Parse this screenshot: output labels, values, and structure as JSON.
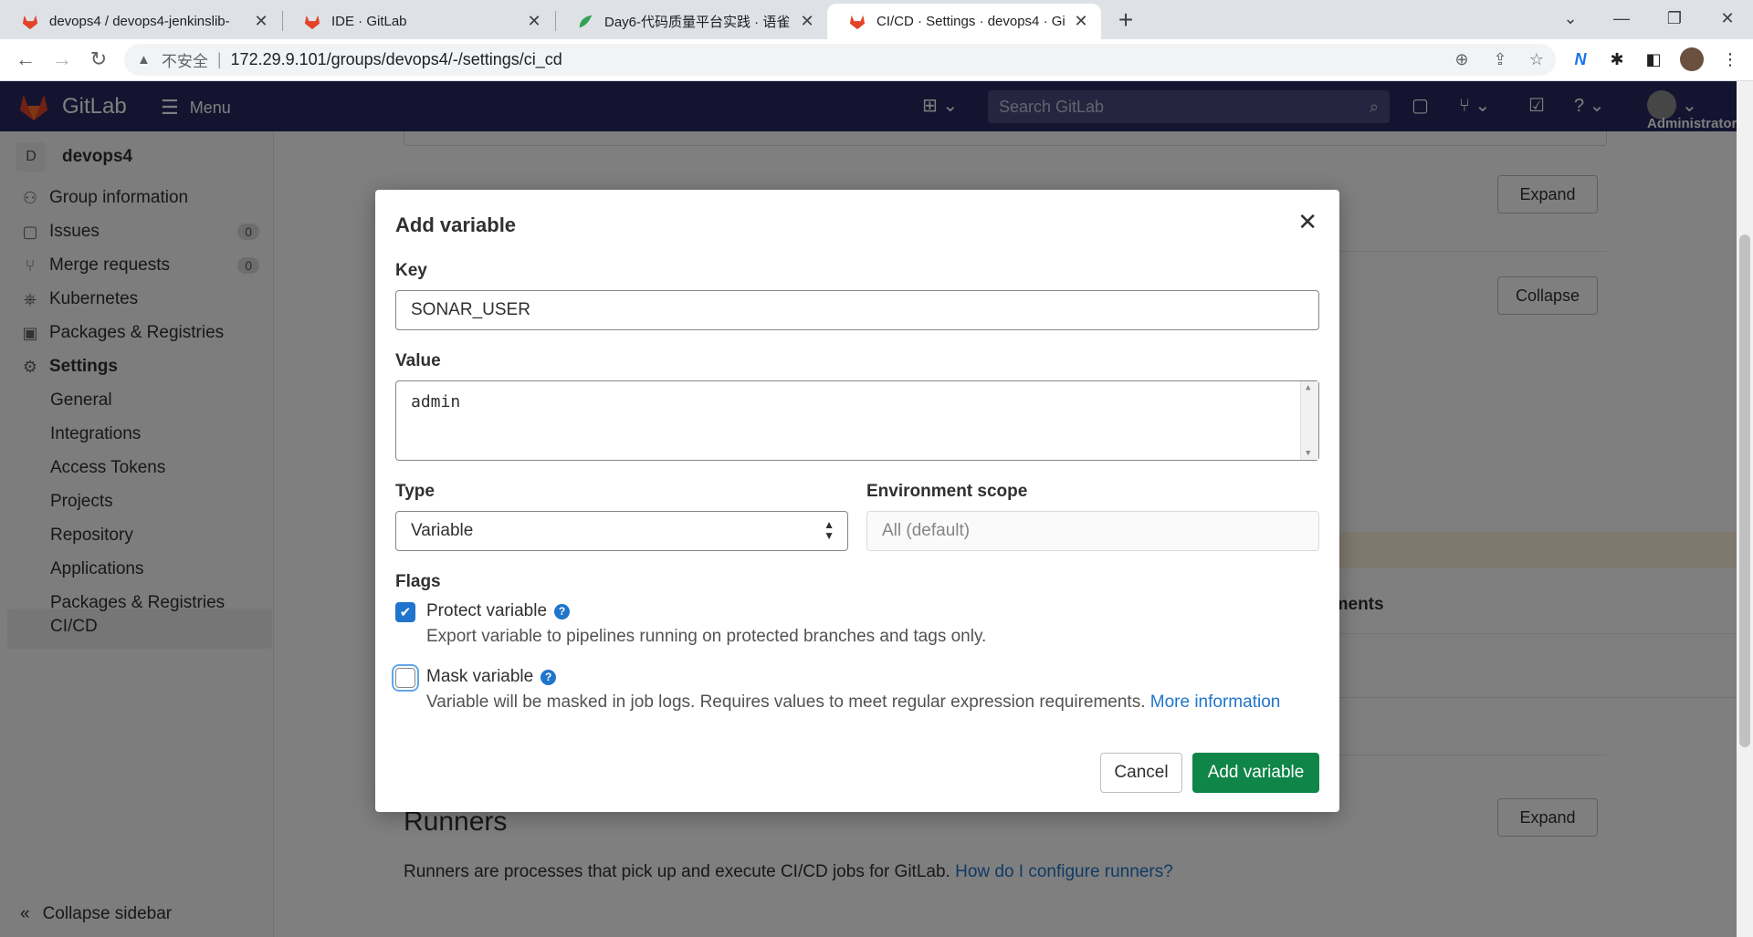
{
  "browser": {
    "tabs": [
      {
        "title": "devops4 / devops4-jenkinslib-",
        "active": false
      },
      {
        "title": "IDE · GitLab",
        "active": false
      },
      {
        "title": "Day6-代码质量平台实践 · 语雀",
        "active": false
      },
      {
        "title": "CI/CD · Settings · devops4 · Gi",
        "active": true
      }
    ],
    "address": {
      "security_label": "不安全",
      "url": "172.29.9.101/groups/devops4/-/settings/ci_cd"
    }
  },
  "gitlab": {
    "brand": "GitLab",
    "menu_label": "Menu",
    "search_placeholder": "Search GitLab",
    "user_label": "Administrator"
  },
  "sidebar": {
    "group_initial": "D",
    "group_name": "devops4",
    "items": [
      {
        "label": "Group information",
        "icon": "group-icon"
      },
      {
        "label": "Issues",
        "icon": "issues-icon",
        "count": "0"
      },
      {
        "label": "Merge requests",
        "icon": "merge-request-icon",
        "count": "0"
      },
      {
        "label": "Kubernetes",
        "icon": "kubernetes-icon"
      },
      {
        "label": "Packages & Registries",
        "icon": "package-icon"
      },
      {
        "label": "Settings",
        "icon": "settings-icon"
      }
    ],
    "sub_items": [
      "General",
      "Integrations",
      "Access Tokens",
      "Projects",
      "Repository",
      "CI/CD",
      "Applications",
      "Packages & Registries"
    ],
    "collapse_label": "Collapse sidebar"
  },
  "content": {
    "expand_label": "Expand",
    "collapse_label": "Collapse",
    "env_text_fragment": "nments",
    "runners_title": "Runners",
    "runners_text": "Runners are processes that pick up and execute CI/CD jobs for GitLab. ",
    "runners_link": "How do I configure runners?"
  },
  "modal": {
    "title": "Add variable",
    "key_label": "Key",
    "key_value": "SONAR_USER",
    "value_label": "Value",
    "value_value": "admin",
    "type_label": "Type",
    "type_value": "Variable",
    "env_label": "Environment scope",
    "env_value": "All (default)",
    "flags_label": "Flags",
    "protect": {
      "label": "Protect variable",
      "checked": true,
      "help": "Export variable to pipelines running on protected branches and tags only."
    },
    "mask": {
      "label": "Mask variable",
      "checked": false,
      "help": "Variable will be masked in job logs. Requires values to meet regular expression requirements. ",
      "link": "More information"
    },
    "cancel_label": "Cancel",
    "submit_label": "Add variable"
  },
  "colors": {
    "gitlab_nav": "#292961",
    "primary_blue": "#1f75cb",
    "confirm_green": "#108548"
  }
}
